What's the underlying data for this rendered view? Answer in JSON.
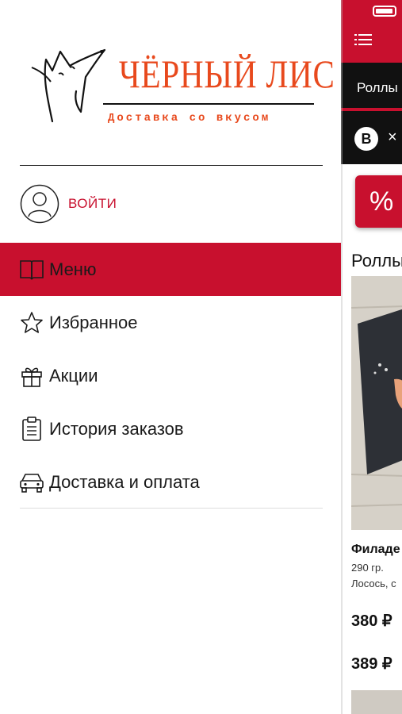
{
  "drawer": {
    "brand": {
      "name": "ЧЁРНЫЙ ЛИС",
      "tagline": "Доставка со вкусом"
    },
    "login_label": "ВОЙТИ",
    "menu": [
      {
        "label": "Меню",
        "icon": "book-icon",
        "active": true
      },
      {
        "label": "Избранное",
        "icon": "star-icon",
        "active": false
      },
      {
        "label": "Акции",
        "icon": "gift-icon",
        "active": false
      },
      {
        "label": "История заказов",
        "icon": "clipboard-icon",
        "active": false
      },
      {
        "label": "Доставка и оплата",
        "icon": "car-icon",
        "active": false
      }
    ]
  },
  "content": {
    "tab_label": "Роллы",
    "promo_badge": "B",
    "promo_close": "×",
    "discount_button": "%",
    "section_title": "Роллы",
    "product": {
      "name": "Филаде",
      "weight": "290 гр.",
      "description": "Лосось, с",
      "price_1": "380 ₽",
      "price_2": "389 ₽"
    }
  },
  "colors": {
    "accent": "#c8102e",
    "brand_orange": "#e8491d",
    "dark": "#111111"
  }
}
